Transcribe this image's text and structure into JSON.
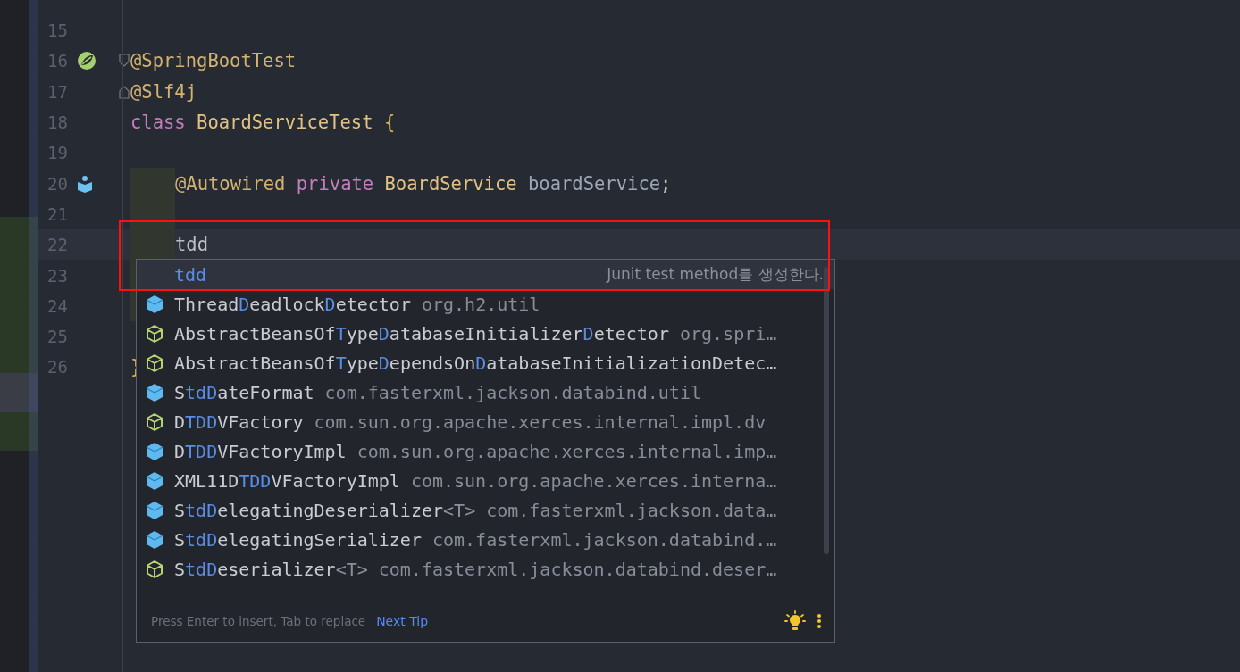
{
  "editor": {
    "lines": [
      {
        "number": "15"
      },
      {
        "number": "16",
        "fold": {
          "kind": "start"
        },
        "gutter": {
          "kind": "spring"
        },
        "tokens": [
          {
            "text": "@SpringBootTest",
            "kind": "annotation"
          }
        ]
      },
      {
        "number": "17",
        "fold": {
          "kind": "end"
        },
        "tokens": [
          {
            "text": "@Slf4j",
            "kind": "annotation"
          }
        ]
      },
      {
        "number": "18",
        "tokens": [
          {
            "text": "class ",
            "kind": "keyword"
          },
          {
            "text": "BoardServiceTest ",
            "kind": "type"
          },
          {
            "text": "{",
            "kind": "brace"
          }
        ]
      },
      {
        "number": "19"
      },
      {
        "number": "20",
        "gutter": {
          "kind": "bean"
        },
        "indent_highlight": true,
        "tokens": [
          {
            "text": "@Autowired ",
            "kind": "annotation"
          },
          {
            "text": "private ",
            "kind": "keyword"
          },
          {
            "text": "BoardService ",
            "kind": "type"
          },
          {
            "text": "boardService",
            "kind": "field"
          },
          {
            "text": ";",
            "kind": "plain"
          }
        ]
      },
      {
        "number": "21",
        "indent_highlight": true
      },
      {
        "number": "22",
        "current": true,
        "indent_highlight": true,
        "tokens": [
          {
            "text": "tdd",
            "kind": "plain"
          }
        ]
      },
      {
        "number": "23",
        "indent_highlight": true
      },
      {
        "number": "24",
        "indent_highlight": true
      },
      {
        "number": "25"
      },
      {
        "number": "26",
        "tokens": [
          {
            "text": "}",
            "kind": "brace"
          }
        ]
      }
    ]
  },
  "completion_popup": {
    "items": [
      {
        "kind": "template",
        "selected": true,
        "name": [
          {
            "text": "tdd",
            "match": true
          }
        ],
        "description": "Junit test method를 생성한다."
      },
      {
        "kind": "class",
        "selected": false,
        "name": [
          {
            "text": "Thread",
            "match": false
          },
          {
            "text": "D",
            "match": true
          },
          {
            "text": "eadlock",
            "match": false
          },
          {
            "text": "D",
            "match": true
          },
          {
            "text": "etector",
            "match": false
          }
        ],
        "package": "org.h2.util"
      },
      {
        "kind": "abstract",
        "selected": false,
        "name": [
          {
            "text": "AbstractBeansOf",
            "match": false
          },
          {
            "text": "T",
            "match": true
          },
          {
            "text": "ype",
            "match": false
          },
          {
            "text": "D",
            "match": true
          },
          {
            "text": "atabaseInitializer",
            "match": false
          },
          {
            "text": "D",
            "match": true
          },
          {
            "text": "etector",
            "match": false
          }
        ],
        "package": "org.spri…"
      },
      {
        "kind": "abstract",
        "selected": false,
        "name": [
          {
            "text": "AbstractBeansOf",
            "match": false
          },
          {
            "text": "T",
            "match": true
          },
          {
            "text": "ype",
            "match": false
          },
          {
            "text": "D",
            "match": true
          },
          {
            "text": "ependsOn",
            "match": false
          },
          {
            "text": "D",
            "match": true
          },
          {
            "text": "atabaseInitializationDetec…",
            "match": false
          }
        ]
      },
      {
        "kind": "class",
        "selected": false,
        "name": [
          {
            "text": "S",
            "match": false
          },
          {
            "text": "tdD",
            "match": true
          },
          {
            "text": "ateFormat",
            "match": false
          }
        ],
        "package": "com.fasterxml.jackson.databind.util"
      },
      {
        "kind": "abstract",
        "selected": false,
        "name": [
          {
            "text": "D",
            "match": false
          },
          {
            "text": "TDD",
            "match": true
          },
          {
            "text": "VFactory",
            "match": false
          }
        ],
        "package": "com.sun.org.apache.xerces.internal.impl.dv"
      },
      {
        "kind": "class",
        "selected": false,
        "name": [
          {
            "text": "D",
            "match": false
          },
          {
            "text": "TDD",
            "match": true
          },
          {
            "text": "VFactoryImpl",
            "match": false
          }
        ],
        "package": "com.sun.org.apache.xerces.internal.imp…"
      },
      {
        "kind": "class",
        "selected": false,
        "name": [
          {
            "text": "XML11D",
            "match": false
          },
          {
            "text": "TDD",
            "match": true
          },
          {
            "text": "VFactoryImpl",
            "match": false
          }
        ],
        "package": "com.sun.org.apache.xerces.interna…"
      },
      {
        "kind": "class",
        "selected": false,
        "name": [
          {
            "text": "S",
            "match": false
          },
          {
            "text": "tdD",
            "match": true
          },
          {
            "text": "elegatingDeserializer",
            "match": false
          }
        ],
        "generic": "<T>",
        "package": "com.fasterxml.jackson.data…"
      },
      {
        "kind": "class",
        "selected": false,
        "name": [
          {
            "text": "S",
            "match": false
          },
          {
            "text": "tdD",
            "match": true
          },
          {
            "text": "elegatingSerializer",
            "match": false
          }
        ],
        "package": "com.fasterxml.jackson.databind.…"
      },
      {
        "kind": "abstract",
        "selected": false,
        "name": [
          {
            "text": "S",
            "match": false
          },
          {
            "text": "tdD",
            "match": true
          },
          {
            "text": "eserializer",
            "match": false
          }
        ],
        "generic": "<T>",
        "package": "com.fasterxml.jackson.databind.deser…"
      }
    ],
    "footer": {
      "hint": "Press Enter to insert, Tab to replace",
      "link": "Next Tip"
    }
  }
}
